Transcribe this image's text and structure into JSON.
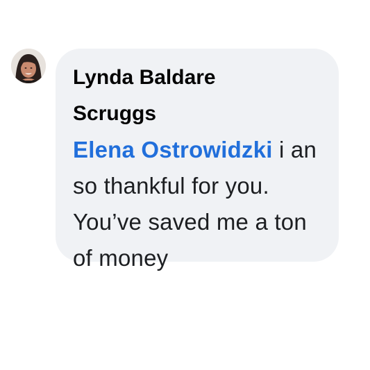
{
  "comment": {
    "author": {
      "name": "Lynda Baldare Scruggs"
    },
    "mention": {
      "name": "Elena Ostrowidzki"
    },
    "text_after_mention": " i an so thankful for you. You’ve saved me a ton of money"
  },
  "colors": {
    "bubble_background": "#f0f2f5",
    "mention_link": "#216fdb",
    "author_name": "#050505",
    "body_text": "#1c1e21"
  }
}
